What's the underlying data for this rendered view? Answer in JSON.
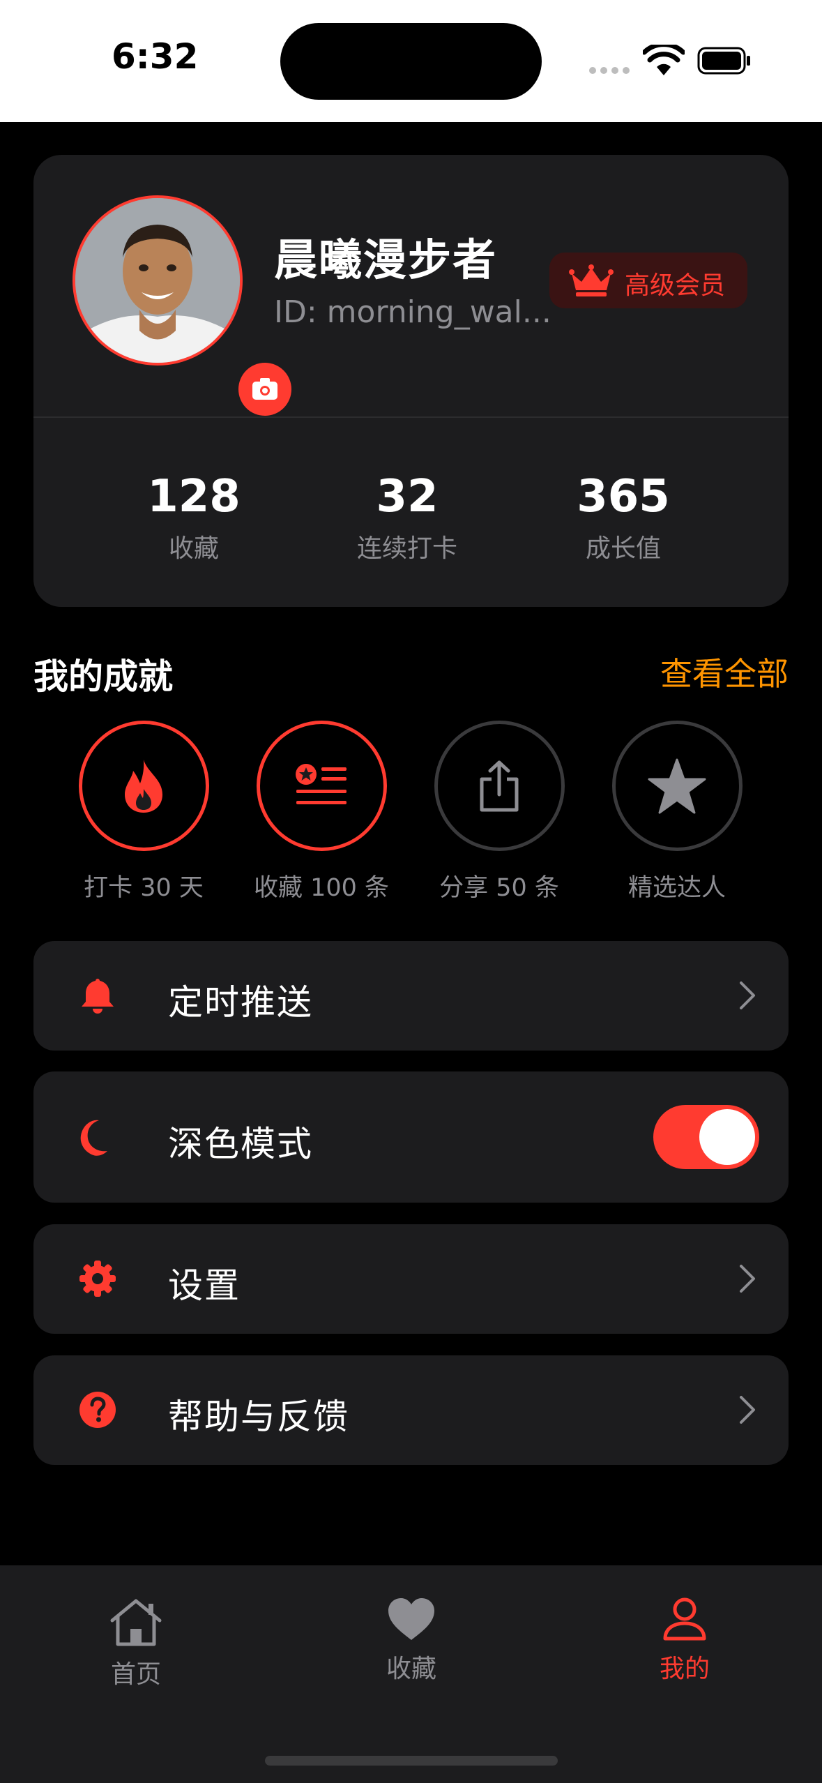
{
  "status_bar": {
    "time": "6:32"
  },
  "profile": {
    "name": "晨曦漫步者",
    "id_text": "ID: morning_wal...",
    "vip_label": "高级会员",
    "stats": [
      {
        "value": "128",
        "label": "收藏"
      },
      {
        "value": "32",
        "label": "连续打卡"
      },
      {
        "value": "365",
        "label": "成长值"
      }
    ]
  },
  "achievements": {
    "title": "我的成就",
    "view_all": "查看全部",
    "items": [
      {
        "label": "打卡 30 天",
        "icon": "flame-icon",
        "unlocked": true
      },
      {
        "label": "收藏 100 条",
        "icon": "starred-list-icon",
        "unlocked": true
      },
      {
        "label": "分享 50 条",
        "icon": "share-icon",
        "unlocked": false
      },
      {
        "label": "精选达人",
        "icon": "star-icon",
        "unlocked": false
      }
    ]
  },
  "menu": {
    "push": {
      "label": "定时推送",
      "icon": "bell-icon"
    },
    "dark_mode": {
      "label": "深色模式",
      "icon": "moon-icon",
      "enabled": true
    },
    "settings": {
      "label": "设置",
      "icon": "gear-icon"
    },
    "help": {
      "label": "帮助与反馈",
      "icon": "question-icon"
    }
  },
  "tabs": [
    {
      "label": "首页",
      "icon": "home-icon",
      "active": false
    },
    {
      "label": "收藏",
      "icon": "heart-icon",
      "active": false
    },
    {
      "label": "我的",
      "icon": "person-icon",
      "active": true
    }
  ],
  "colors": {
    "accent": "#ff3b30",
    "link": "#ff9500",
    "card": "#1c1c1e",
    "background": "#000000"
  }
}
